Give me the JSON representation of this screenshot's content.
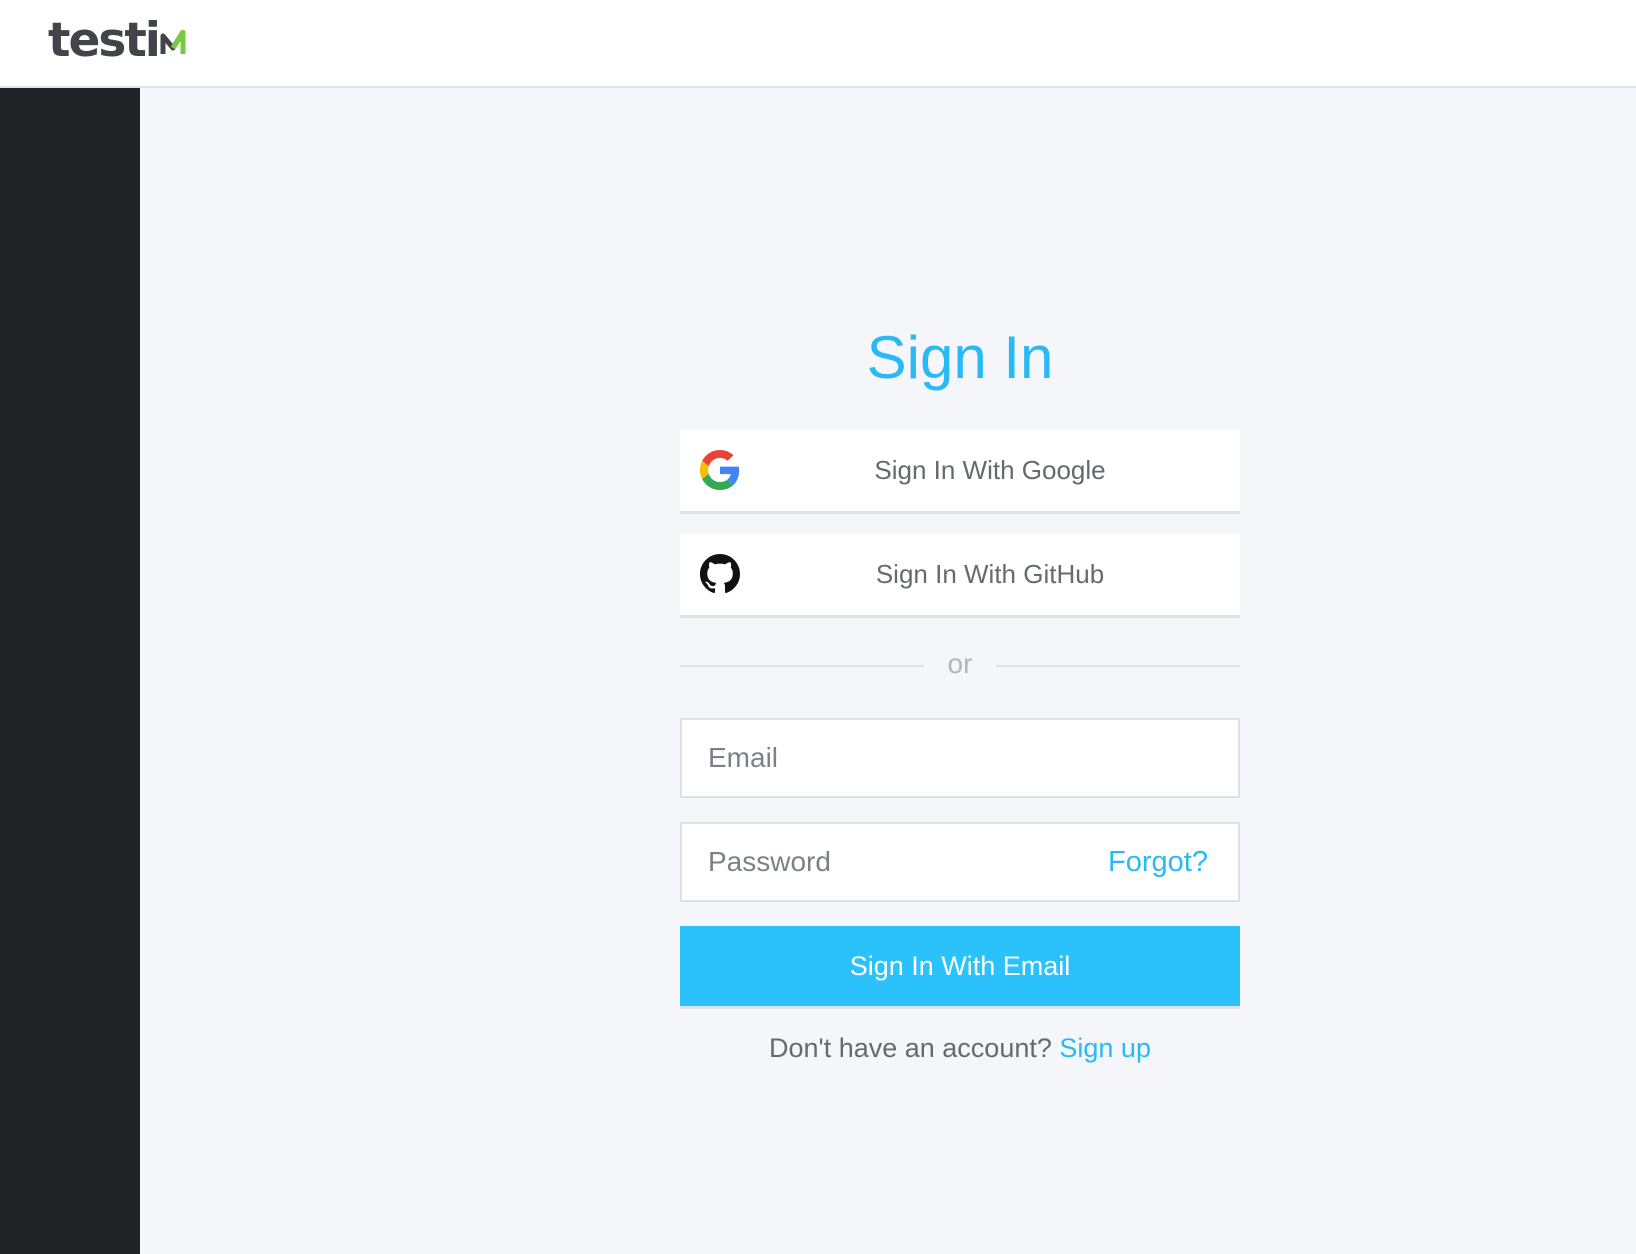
{
  "header": {
    "logo_text": "testi",
    "logo_colors": {
      "text": "#414449",
      "accent": "#7ac943"
    }
  },
  "signin": {
    "title": "Sign In",
    "google_button": {
      "label": "Sign In With Google",
      "icon": "google-icon"
    },
    "github_button": {
      "label": "Sign In With GitHub",
      "icon": "github-icon"
    },
    "divider_text": "or",
    "email_field": {
      "placeholder": "Email",
      "value": ""
    },
    "password_field": {
      "placeholder": "Password",
      "value": ""
    },
    "forgot_label": "Forgot?",
    "submit_label": "Sign In With Email",
    "signup_prompt": "Don't have an account?",
    "signup_link": "Sign up"
  },
  "colors": {
    "accent": "#29b9f5",
    "button": "#2bc1fb",
    "sidebar": "#212225",
    "background": "#f4f6f9"
  }
}
